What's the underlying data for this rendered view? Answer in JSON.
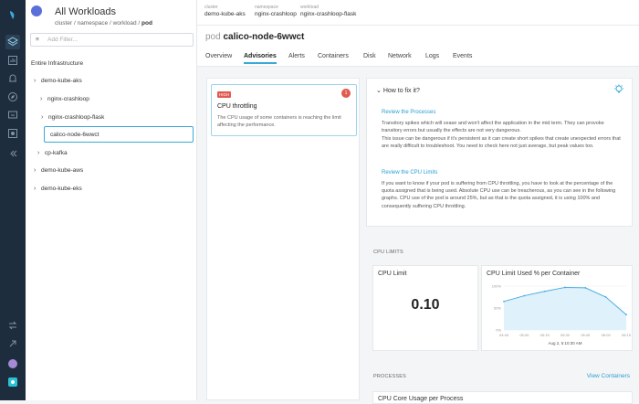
{
  "sidebar": {
    "title": "All Workloads",
    "breadcrumb": {
      "a": "cluster",
      "b": "namespace",
      "c": "workload",
      "d": "pod"
    },
    "filter_placeholder": "Add Filter...",
    "section": "Entire Infrastructure",
    "tree": [
      {
        "label": "demo-kube-aks",
        "caret": "›"
      },
      {
        "label": "nginx-crashloop",
        "caret": "›"
      },
      {
        "label": "nginx-crashloop-flask",
        "caret": "›"
      },
      {
        "label": "calico-node-6wwct",
        "caret": ""
      },
      {
        "label": "cp-kafka",
        "caret": "›"
      },
      {
        "label": "demo-kube-aws",
        "caret": "›"
      },
      {
        "label": "demo-kube-eks",
        "caret": "›"
      }
    ]
  },
  "topbar": {
    "crumbs": [
      {
        "k": "cluster",
        "v": "demo-kube-aks"
      },
      {
        "k": "namespace",
        "v": "nginx-crashloop"
      },
      {
        "k": "workload",
        "v": "nginx-crashloop-flask"
      }
    ]
  },
  "header": {
    "prefix": "pod",
    "name": "calico-node-6wwct"
  },
  "tabs": [
    "Overview",
    "Advisories",
    "Alerts",
    "Containers",
    "Disk",
    "Network",
    "Logs",
    "Events"
  ],
  "advisory": {
    "badge": "HIGH",
    "count": "1",
    "title": "CPU throttling",
    "desc": "The CPU usage of some containers is reaching the limit affecting the performance."
  },
  "fix": {
    "heading": "How to fix it?",
    "s1_title": "Review the Processes",
    "s1_text": "Transitory spikes which will cease and won't affect the application in the mid term. They can provoke transitory errors but usually the effects are not very dangerous.",
    "s1_text2": "This issue can be dangerous if it's persistent as it can create short spikes that create unexpected errors that are really difficult to troubleshoot. You need to check here not just average, but peak values too.",
    "s2_title": "Review the CPU Limits",
    "s2_text": "If you want to know if your pod is suffering from CPU throttling, you have to look at the percentage of the quota assigned that is being used. Absolute CPU use can be treacherous, as you can see in the following graphs. CPU use of the pod is around 25%, but as that is the quota assigned, it is using 100% and consequently suffering CPU throttling."
  },
  "cpu_limits": {
    "section": "CPU LIMITS",
    "limit_title": "CPU Limit",
    "limit_value": "0.10",
    "chart_title": "CPU Limit Used % per Container",
    "y_ticks": [
      "100%",
      "50%",
      "0%"
    ],
    "x_ticks": [
      "04:45",
      "05:00",
      "05:15",
      "05:30",
      "05:45",
      "06:00",
      "06:15"
    ],
    "date_label": "Aug 2, 5:10:30 AM"
  },
  "processes": {
    "section": "PROCESSES",
    "link": "View Containers",
    "sub": "CPU Core Usage per Process"
  },
  "colors": {
    "accent": "#3aa8d8",
    "rail": "#1e2d3d",
    "danger": "#e05a4f"
  },
  "chart_data": {
    "type": "line",
    "title": "CPU Limit Used % per Container",
    "x": [
      "04:45",
      "05:00",
      "05:15",
      "05:30",
      "05:45",
      "06:00",
      "06:15"
    ],
    "series": [
      {
        "values": [
          65,
          78,
          88,
          97,
          96,
          75,
          35
        ]
      }
    ],
    "ylim": [
      0,
      100
    ]
  }
}
